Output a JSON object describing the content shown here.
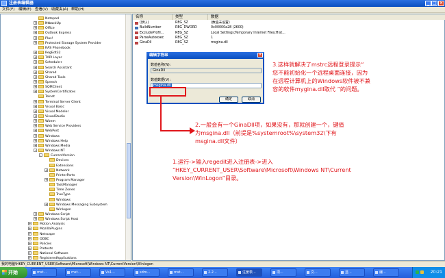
{
  "window": {
    "title": "注册表编辑器"
  },
  "menu": [
    "文件(F)",
    "编辑(E)",
    "查看(V)",
    "收藏夹(A)",
    "帮助(H)"
  ],
  "tree_nodes": [
    {
      "label": "Notepad",
      "exp": ""
    },
    {
      "label": "NtbackUp",
      "exp": "+"
    },
    {
      "label": "Office",
      "exp": "+"
    },
    {
      "label": "Outlook Express",
      "exp": "+"
    },
    {
      "label": "Plus!",
      "exp": "+"
    },
    {
      "label": "Protected Storage System Provider",
      "exp": "+"
    },
    {
      "label": "RAS Phonebook",
      "exp": ""
    },
    {
      "label": "RegEdt32",
      "exp": "+"
    },
    {
      "label": "TAPI Layer",
      "exp": "+"
    },
    {
      "label": "Schedule+",
      "exp": "+"
    },
    {
      "label": "Search Assistant",
      "exp": "+"
    },
    {
      "label": "Shared",
      "exp": "+"
    },
    {
      "label": "Shared Tools",
      "exp": "+"
    },
    {
      "label": "Speech",
      "exp": "+"
    },
    {
      "label": "SQMClient",
      "exp": "+"
    },
    {
      "label": "SystemCertificates",
      "exp": "+"
    },
    {
      "label": "Telnet",
      "exp": ""
    },
    {
      "label": "Terminal Server Client",
      "exp": "+"
    },
    {
      "label": "Visual Basic",
      "exp": "+"
    },
    {
      "label": "Visual Modeler",
      "exp": "+"
    },
    {
      "label": "VisualStudio",
      "exp": "+"
    },
    {
      "label": "Wbem",
      "exp": "+"
    },
    {
      "label": "Web Service Providers",
      "exp": "+"
    },
    {
      "label": "WebPost",
      "exp": "+"
    },
    {
      "label": "Windows",
      "exp": "+"
    },
    {
      "label": "Windows Help",
      "exp": "+"
    },
    {
      "label": "Windows Media",
      "exp": "+"
    },
    {
      "label": "Windows NT",
      "exp": "-"
    },
    {
      "label": "CurrentVersion",
      "exp": "-"
    },
    {
      "label": "Devices",
      "exp": ""
    },
    {
      "label": "Extensions",
      "exp": ""
    },
    {
      "label": "Network",
      "exp": "+"
    },
    {
      "label": "PrinterPorts",
      "exp": ""
    },
    {
      "label": "Program Manager",
      "exp": "+"
    },
    {
      "label": "TaskManager",
      "exp": ""
    },
    {
      "label": "Time Zones",
      "exp": ""
    },
    {
      "label": "TrueType",
      "exp": ""
    },
    {
      "label": "Windows",
      "exp": ""
    },
    {
      "label": "Windows Messaging Subsystem",
      "exp": "+"
    },
    {
      "label": "Winlogon",
      "exp": ""
    },
    {
      "label": "Windows Script",
      "exp": "+"
    },
    {
      "label": "Windows Script Host",
      "exp": "+"
    },
    {
      "label": "Motion Analysis",
      "exp": "+"
    },
    {
      "label": "MozillaPlugins",
      "exp": "+"
    },
    {
      "label": "Netscape",
      "exp": "+"
    },
    {
      "label": "ODBC",
      "exp": "+"
    },
    {
      "label": "Policies",
      "exp": "+"
    },
    {
      "label": "Pretexts",
      "exp": "+"
    },
    {
      "label": "National Software",
      "exp": "+"
    },
    {
      "label": "RegisteredApplications",
      "exp": "+"
    }
  ],
  "columns": [
    "名称",
    "类型",
    "数据"
  ],
  "values": [
    {
      "name": "(默认)",
      "type": "REG_SZ",
      "data": "(数值未设置)"
    },
    {
      "name": "BuildNumber",
      "type": "REG_DWORD",
      "data": "0x00000a28 (2600)"
    },
    {
      "name": "ExcludeProfil...",
      "type": "REG_SZ",
      "data": "Local Settings;Temporary Internet Files;Hist..."
    },
    {
      "name": "ParseAutoexec",
      "type": "REG_SZ",
      "data": "1"
    },
    {
      "name": "GinaDll",
      "type": "REG_SZ",
      "data": "msgina.dll"
    }
  ],
  "dialog": {
    "title": "编辑字符串",
    "close": "×",
    "name_label": "数值名称(N):",
    "name_value": "GinaDll",
    "data_label": "数值数据(V):",
    "data_value": "msgina.dll",
    "ok": "确定",
    "cancel": "取消"
  },
  "annotations": {
    "step1_line1": "1.运行->输入regedit进入注册表->进入",
    "step1_line2": "“HKEY_CURRENT_USER\\Software\\Microsoft\\Windows NT\\Current",
    "step1_line3": "Version\\WinLogon”目录。",
    "step2_line1": "2.一般会有一个GinaDll项，如果没有，那就创建一个，键值",
    "step2_line2": "为msgina.dll（前提是%systemroot%\\system32\\下有",
    "step2_line3": "msgina.dll文件）",
    "step3_line1": "3.这样就解决了mstrc远程登录提示“",
    "step3_line2": "您不能初始化一个远程桌面连接，因为",
    "step3_line3": "在远程计算机上的Windows软件被不兼",
    "step3_line4": "容的软件mygina.dll取代 ”的问题。"
  },
  "status": "我的电脑\\HKEY_CURRENT_USER\\Software\\Microsoft\\Windows NT\\CurrentVersion\\Winlogon",
  "taskbar": {
    "start": "开始",
    "buttons": [
      "mst...",
      "mst...",
      "Vs1...",
      "sdm...",
      "mst...",
      "2.2...",
      "注册表...",
      "项...",
      "文...",
      "显...",
      "编..."
    ],
    "clock": "20:21"
  },
  "colors": {
    "annotation": "#e0151a",
    "titlebar": "#0a4fc0",
    "taskbar": "#245edb"
  }
}
